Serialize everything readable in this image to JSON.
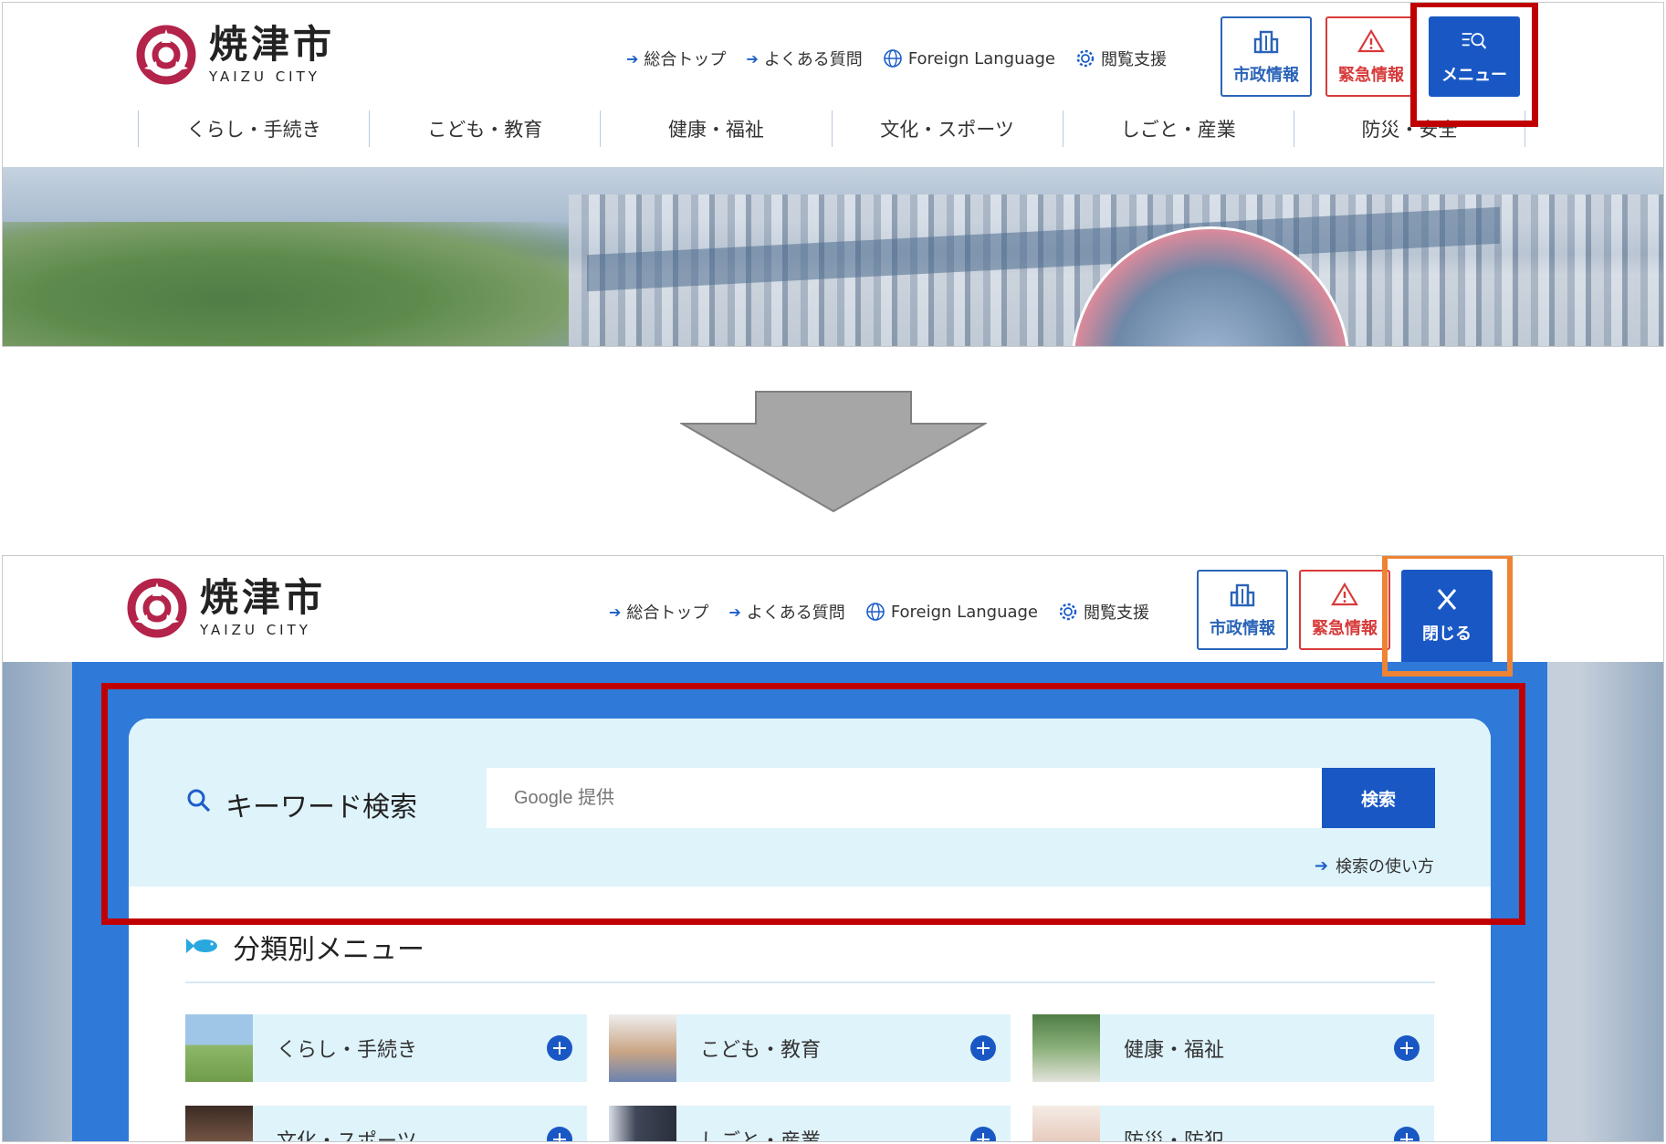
{
  "logo": {
    "kanji": "焼津市",
    "roman": "YAIZU CITY"
  },
  "util_links": [
    {
      "label": "総合トップ",
      "icon": "arrow-right-icon"
    },
    {
      "label": "よくある質問",
      "icon": "arrow-right-icon"
    },
    {
      "label": "Foreign Language",
      "icon": "globe-icon"
    },
    {
      "label": "閲覧支援",
      "icon": "gear-icon"
    }
  ],
  "header_buttons": {
    "city": {
      "label": "市政情報",
      "icon": "building-icon"
    },
    "emergency": {
      "label": "緊急情報",
      "icon": "warning-icon"
    },
    "menu": {
      "label": "メニュー",
      "icon": "menu-search-icon"
    },
    "close": {
      "label": "閉じる",
      "icon": "close-icon"
    }
  },
  "global_nav": [
    "くらし・手続き",
    "こども・教育",
    "健康・福祉",
    "文化・スポーツ",
    "しごと・産業",
    "防災・安全"
  ],
  "search": {
    "title": "キーワード検索",
    "placeholder": "Google 提供",
    "button": "検索",
    "help_link": "検索の使い方"
  },
  "category_menu": {
    "heading": "分類別メニュー",
    "items": [
      {
        "label": "くらし・手続き",
        "thumb_color": "#8fb86a"
      },
      {
        "label": "こども・教育",
        "thumb_color": "#c9a585"
      },
      {
        "label": "健康・福祉",
        "thumb_color": "#6f9c5a"
      },
      {
        "label": "文化・スポーツ",
        "thumb_color": "#7a5a48"
      },
      {
        "label": "しごと・産業",
        "thumb_color": "#3e4658"
      },
      {
        "label": "防災・防犯",
        "thumb_color": "#e5c7b8"
      }
    ]
  },
  "colors": {
    "brand_blue": "#1958c4",
    "panel_blue": "#2f79d9",
    "light_blue": "#dff3fb",
    "emergency_red": "#d83a3a",
    "highlight_red": "#c00000",
    "highlight_orange": "#ee8433",
    "logo_crimson": "#b3234a"
  }
}
